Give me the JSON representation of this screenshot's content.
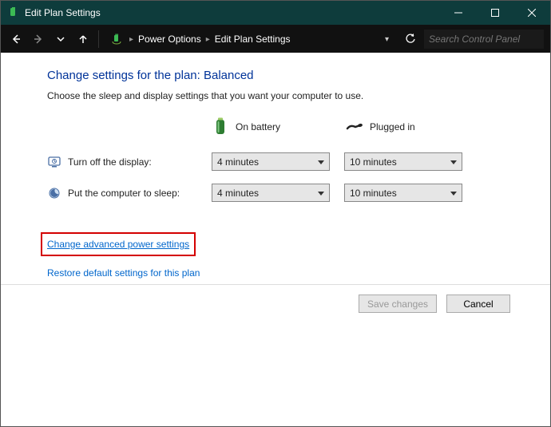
{
  "window": {
    "title": "Edit Plan Settings"
  },
  "breadcrumb": {
    "items": [
      "Power Options",
      "Edit Plan Settings"
    ]
  },
  "search": {
    "placeholder": "Search Control Panel"
  },
  "page": {
    "heading_prefix": "Change settings for the plan: ",
    "heading_plan": "Balanced",
    "subtext": "Choose the sleep and display settings that you want your computer to use."
  },
  "columns": {
    "battery": "On battery",
    "plugged": "Plugged in"
  },
  "rows": {
    "display": {
      "label": "Turn off the display:",
      "battery_value": "4 minutes",
      "plugged_value": "10 minutes"
    },
    "sleep": {
      "label": "Put the computer to sleep:",
      "battery_value": "4 minutes",
      "plugged_value": "10 minutes"
    }
  },
  "links": {
    "advanced": "Change advanced power settings",
    "restore": "Restore default settings for this plan"
  },
  "buttons": {
    "save": "Save changes",
    "cancel": "Cancel"
  }
}
